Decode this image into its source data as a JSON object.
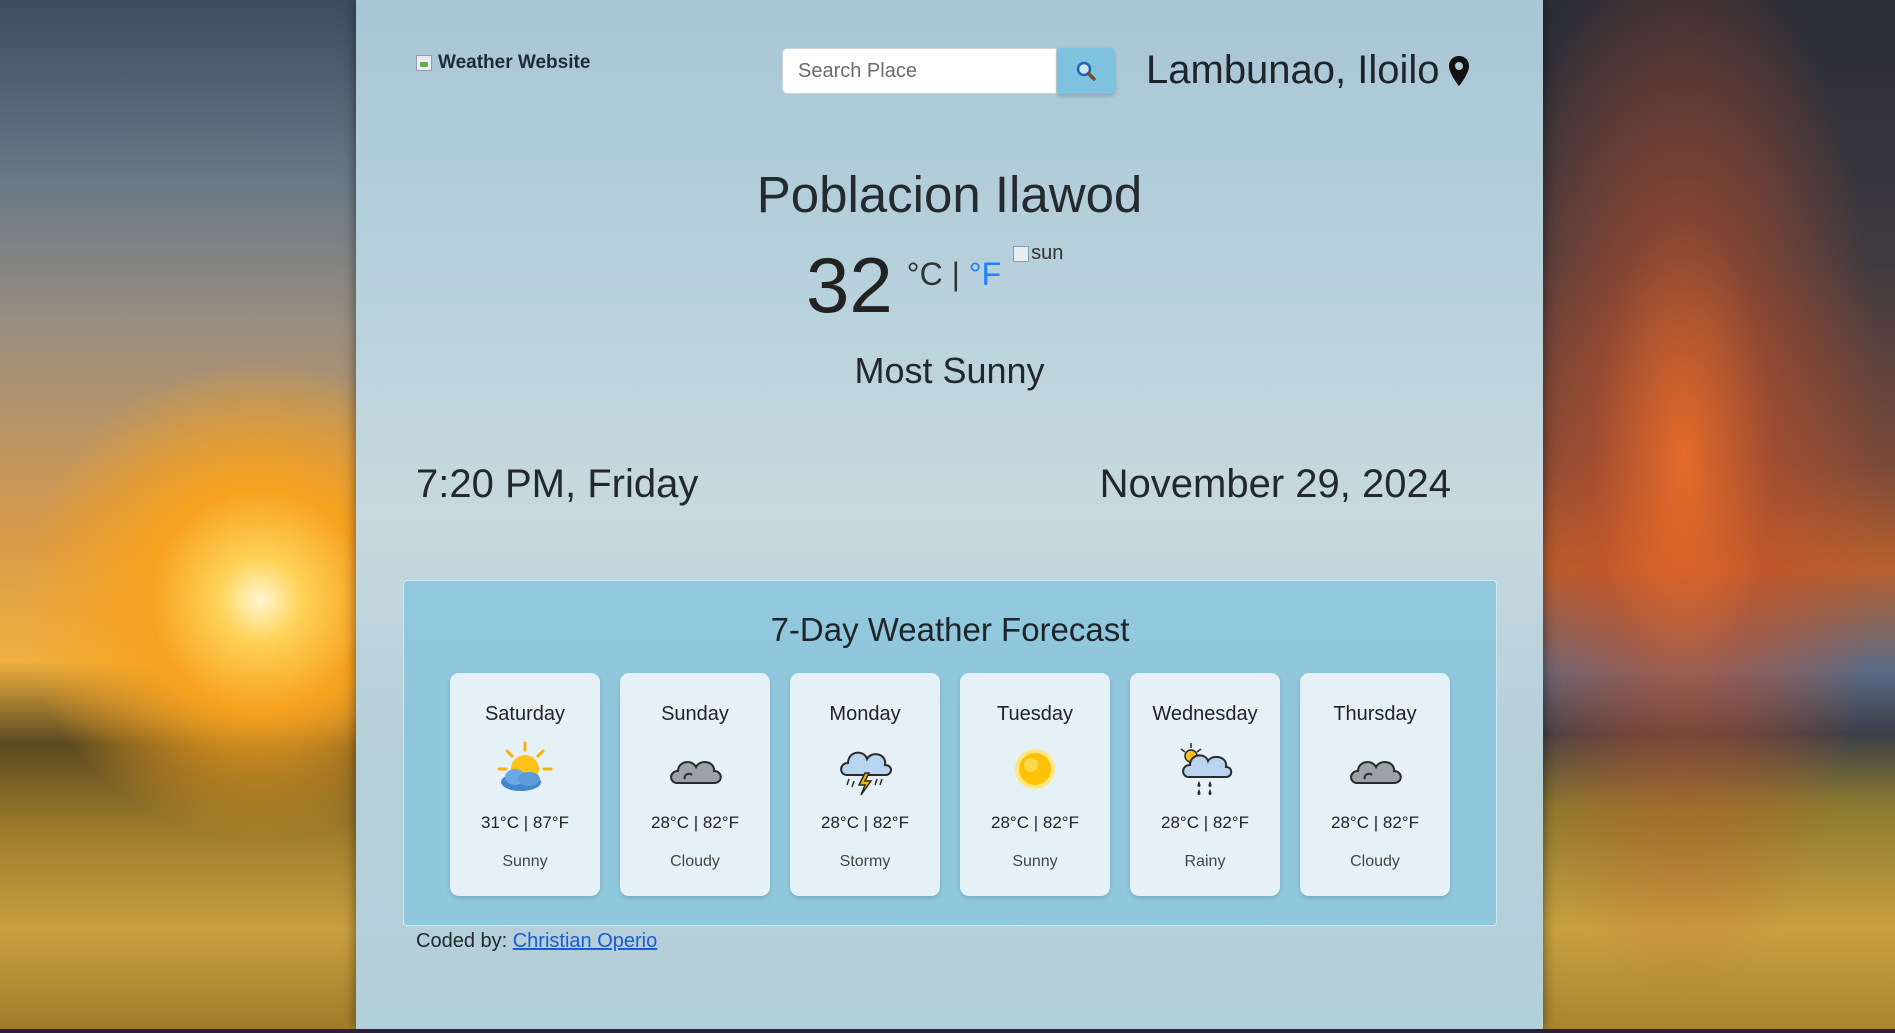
{
  "brand": {
    "alt_text": "Weather Website"
  },
  "search": {
    "placeholder": "Search Place"
  },
  "location": {
    "name": "Lambunao, Iloilo"
  },
  "current": {
    "place": "Poblacion Ilawod",
    "temperature": "32",
    "unit_c": "°C",
    "unit_sep": " | ",
    "unit_f": "°F",
    "icon_alt": "sun",
    "condition": "Most Sunny",
    "time_day": "7:20 PM, Friday",
    "date": "November 29, 2024"
  },
  "forecast": {
    "title": "7-Day Weather Forecast",
    "days": [
      {
        "day": "Saturday",
        "temps": "31°C | 87°F",
        "condition": "Sunny",
        "icon": "sun-cloud-icon"
      },
      {
        "day": "Sunday",
        "temps": "28°C | 82°F",
        "condition": "Cloudy",
        "icon": "cloud-icon"
      },
      {
        "day": "Monday",
        "temps": "28°C | 82°F",
        "condition": "Stormy",
        "icon": "storm-icon"
      },
      {
        "day": "Tuesday",
        "temps": "28°C | 82°F",
        "condition": "Sunny",
        "icon": "sun-icon"
      },
      {
        "day": "Wednesday",
        "temps": "28°C | 82°F",
        "condition": "Rainy",
        "icon": "rain-icon"
      },
      {
        "day": "Thursday",
        "temps": "28°C | 82°F",
        "condition": "Cloudy",
        "icon": "cloud-icon"
      }
    ]
  },
  "footer": {
    "prefix": "Coded by: ",
    "author": "Christian Operio"
  },
  "colors": {
    "accent": "#1f7fff",
    "search_button": "#7ec2e0",
    "link": "#1a5bd6"
  }
}
